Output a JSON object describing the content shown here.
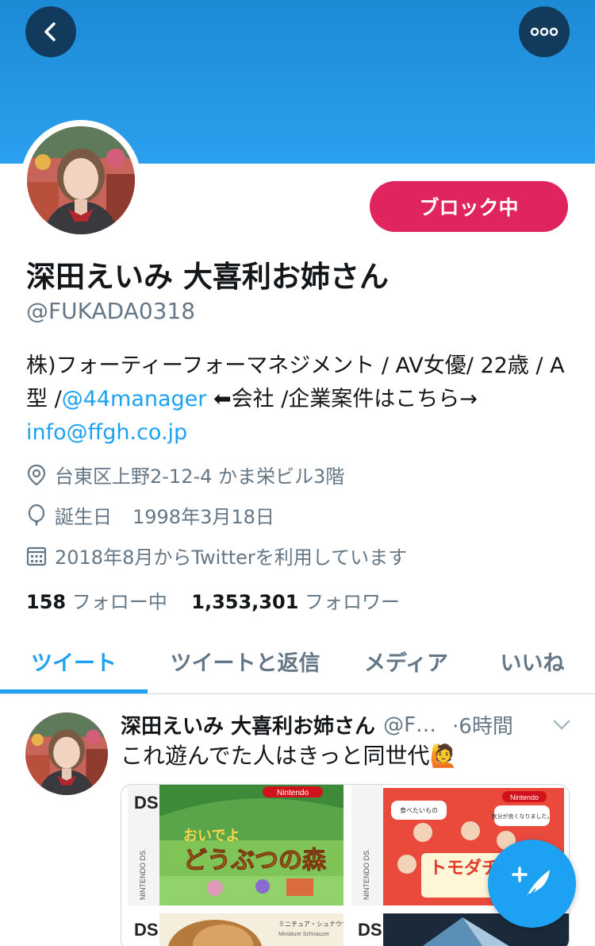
{
  "header": {
    "back_icon": "back-arrow-icon",
    "more_icon": "more-dots-icon",
    "banner_color": "#2ba0ee"
  },
  "profile": {
    "block_label": "ブロック中",
    "name": "深田えいみ 大喜利お姉さん",
    "handle": "@FUKADA0318",
    "bio_part1": "株)フォーティーフォーマネジメント / AV女優/ 22歳 / A型 /",
    "bio_link1": "@44manager",
    "bio_part2": " ⬅会社 /企業案件はこちら→",
    "bio_link2": "info@ffgh.co.jp",
    "location": "台東区上野2-12-4 かま栄ビル3階",
    "birthday_label": "誕生日",
    "birthday": "1998年3月18日",
    "joined": "2018年8月からTwitterを利用しています",
    "following_count": "158",
    "following_label": "フォロー中",
    "followers_count": "1,353,301",
    "followers_label": "フォロワー"
  },
  "tabs": [
    {
      "label": "ツイート",
      "active": true
    },
    {
      "label": "ツイートと返信",
      "active": false
    },
    {
      "label": "メディア",
      "active": false
    },
    {
      "label": "いいね",
      "active": false
    }
  ],
  "tweet": {
    "name": "深田えいみ 大喜利お姉さん",
    "handle": "@F…",
    "time": "·6時間",
    "text": "これ遊んでた人はきっと同世代🙋",
    "media": [
      {
        "brand": "NINTENDO DS.",
        "title": "どうぶつの森",
        "subtitle": "おいでよ",
        "logo": "Nintendo"
      },
      {
        "brand": "NINTENDO DS.",
        "title": "トモダチ コレクショ",
        "bubble1": "気分が良くなりました。",
        "bubble2": "食べたいもの",
        "logo": "Nintendo"
      },
      {
        "brand": "DS",
        "title": "ミニチュア・シュナウザー",
        "subtitle": "Miniature Schnauzer"
      },
      {
        "brand": "DS",
        "title": ""
      }
    ]
  },
  "accent_color": "#1da1f2",
  "block_color": "#e0245e",
  "compose_icon": "compose-feather-icon"
}
